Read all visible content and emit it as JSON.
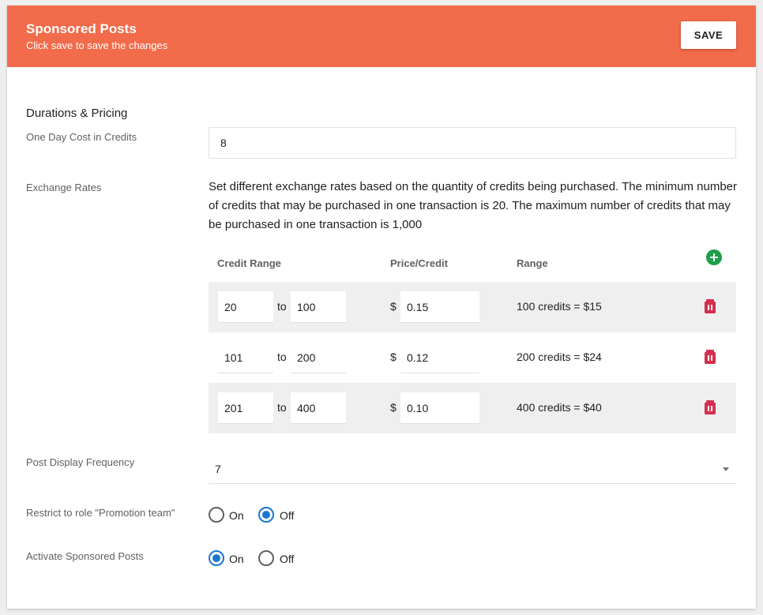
{
  "header": {
    "title": "Sponsored Posts",
    "subtitle": "Click save to save the changes",
    "save_label": "SAVE",
    "color": "#f26b4a"
  },
  "section_title": "Durations & Pricing",
  "one_day_cost": {
    "label": "One Day Cost in Credits",
    "value": "8"
  },
  "exchange_rates": {
    "label": "Exchange Rates",
    "description": "Set different exchange rates based on the quantity of credits being purchased. The minimum number of credits that may be purchased in one transaction is 20. The maximum number of credits that may be purchased in one transaction is 1,000",
    "columns": {
      "credit_range": "Credit Range",
      "price_credit": "Price/Credit",
      "range": "Range"
    },
    "to_label": "to",
    "currency": "$",
    "rows": [
      {
        "from": "20",
        "to": "100",
        "price": "0.15",
        "range": "100 credits = $15"
      },
      {
        "from": "101",
        "to": "200",
        "price": "0.12",
        "range": "200 credits = $24"
      },
      {
        "from": "201",
        "to": "400",
        "price": "0.10",
        "range": "400 credits = $40"
      }
    ]
  },
  "post_display_frequency": {
    "label": "Post Display Frequency",
    "value": "7"
  },
  "restrict_role": {
    "label": "Restrict to role \"Promotion team\"",
    "on": "On",
    "off": "Off",
    "selected": "Off"
  },
  "activate": {
    "label": "Activate Sponsored Posts",
    "on": "On",
    "off": "Off",
    "selected": "On"
  },
  "colors": {
    "accent": "#1976d2",
    "add": "#1e9e4a",
    "delete": "#d32f4f"
  }
}
